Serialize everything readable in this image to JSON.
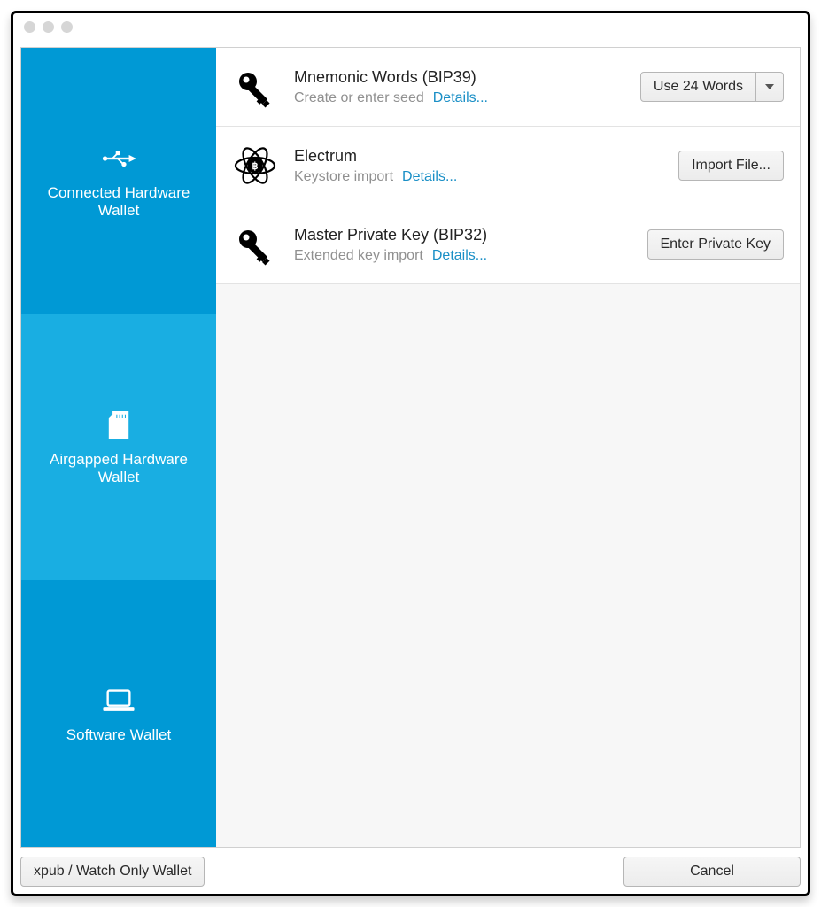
{
  "sidebar": {
    "items": [
      {
        "label": "Connected Hardware Wallet"
      },
      {
        "label": "Airgapped Hardware Wallet"
      },
      {
        "label": "Software Wallet"
      }
    ]
  },
  "options": [
    {
      "title": "Mnemonic Words (BIP39)",
      "subtitle": "Create or enter seed",
      "details": "Details...",
      "action": "Use 24 Words",
      "split": true
    },
    {
      "title": "Electrum",
      "subtitle": "Keystore import",
      "details": "Details...",
      "action": "Import File...",
      "split": false
    },
    {
      "title": "Master Private Key (BIP32)",
      "subtitle": "Extended key import",
      "details": "Details...",
      "action": "Enter Private Key",
      "split": false
    }
  ],
  "footer": {
    "xpub": "xpub / Watch Only Wallet",
    "cancel": "Cancel"
  }
}
